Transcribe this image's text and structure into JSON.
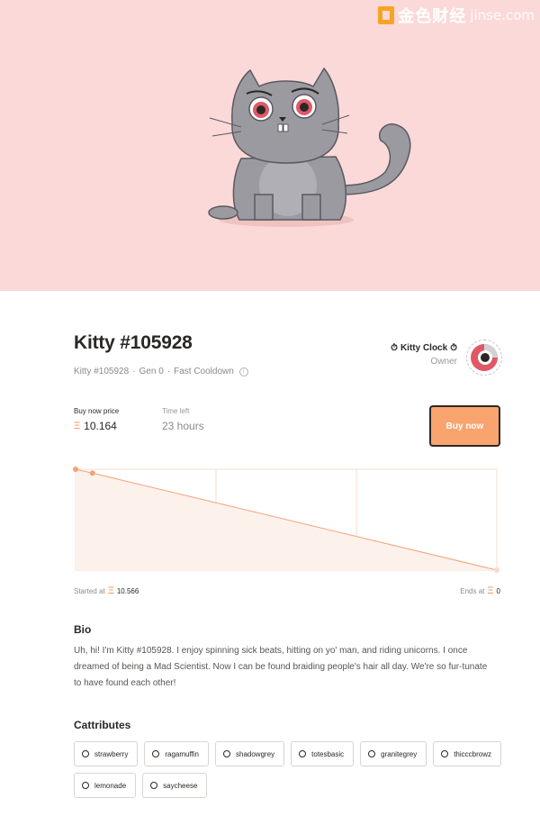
{
  "watermark": {
    "brand_cn": "金色财经",
    "domain": "jinse.com"
  },
  "kitty": {
    "title": "Kitty #105928",
    "name": "Kitty #105928",
    "gen": "Gen 0",
    "cooldown": "Fast Cooldown",
    "info_icon": "i"
  },
  "owner": {
    "clock_icon": "⏱",
    "name": "Kitty Clock",
    "role": "Owner"
  },
  "sale": {
    "price_label": "Buy now price",
    "currency_symbol": "Ξ",
    "price": "10.164",
    "time_label": "Time left",
    "time_value": "23 hours",
    "buy_label": "Buy now",
    "started_prefix": "Started at",
    "start_price": "10.566",
    "ends_prefix": "Ends at",
    "end_price": "0"
  },
  "chart_data": {
    "type": "line",
    "x": [
      0,
      0.04,
      1
    ],
    "y": [
      10.566,
      10.164,
      0
    ],
    "xlim": [
      0,
      1
    ],
    "ylim": [
      0,
      10.566
    ],
    "vertical_gridlines": 2,
    "accent_color": "#f3a27a"
  },
  "bio": {
    "heading": "Bio",
    "text": "Uh, hi! I'm Kitty #105928. I enjoy spinning sick beats, hitting on yo' man, and riding unicorns. I once dreamed of being a Mad Scientist. Now I can be found braiding people's hair all day. We're so fur-tunate to have found each other!"
  },
  "cattributes": {
    "heading": "Cattributes",
    "items": [
      "strawberry",
      "ragamuffin",
      "shadowgrey",
      "totesbasic",
      "granitegrey",
      "thicccbrowz",
      "lemonade",
      "saycheese"
    ]
  },
  "colors": {
    "hero_bg": "#fbd9d8",
    "accent": "#f9a36f",
    "cat_body": "#9b9aa0"
  }
}
